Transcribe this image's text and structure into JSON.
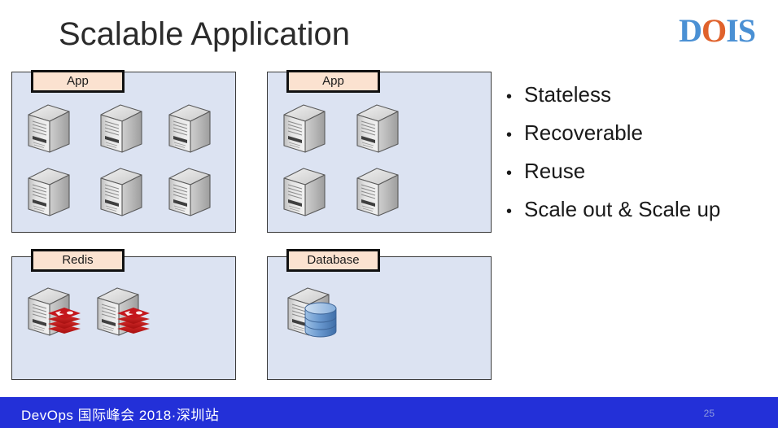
{
  "slide": {
    "title": "Scalable Application",
    "page_number": "25",
    "background_color": "#ffffff"
  },
  "logo": {
    "name": "DOIS",
    "letters": [
      {
        "char": "D",
        "color": "#4a90d4"
      },
      {
        "char": "O",
        "color": "#e0622c"
      },
      {
        "char": "I",
        "color": "#4a90d4"
      },
      {
        "char": "S",
        "color": "#4a90d4"
      }
    ]
  },
  "panels": [
    {
      "id": "app1",
      "label": "App",
      "server_count": 6,
      "fill_color": "#dce3f2",
      "label_fill": "#fbe2d0"
    },
    {
      "id": "app2",
      "label": "App",
      "server_count": 4,
      "fill_color": "#dce3f2",
      "label_fill": "#fbe2d0"
    },
    {
      "id": "redis",
      "label": "Redis",
      "server_count": 2,
      "fill_color": "#dce3f2",
      "label_fill": "#fbe2d0",
      "accent_color": "#c4161c"
    },
    {
      "id": "database",
      "label": "Database",
      "server_count": 1,
      "fill_color": "#dce3f2",
      "label_fill": "#fbe2d0",
      "accent_color": "#6e9bd1"
    }
  ],
  "bullets": {
    "marker": "•",
    "items": [
      "Stateless",
      "Recoverable",
      "Reuse",
      "Scale out & Scale up"
    ]
  },
  "footer": {
    "text": "DevOps 国际峰会 2018·深圳站",
    "background_color": "#2330d8",
    "text_color": "#ffffff"
  }
}
